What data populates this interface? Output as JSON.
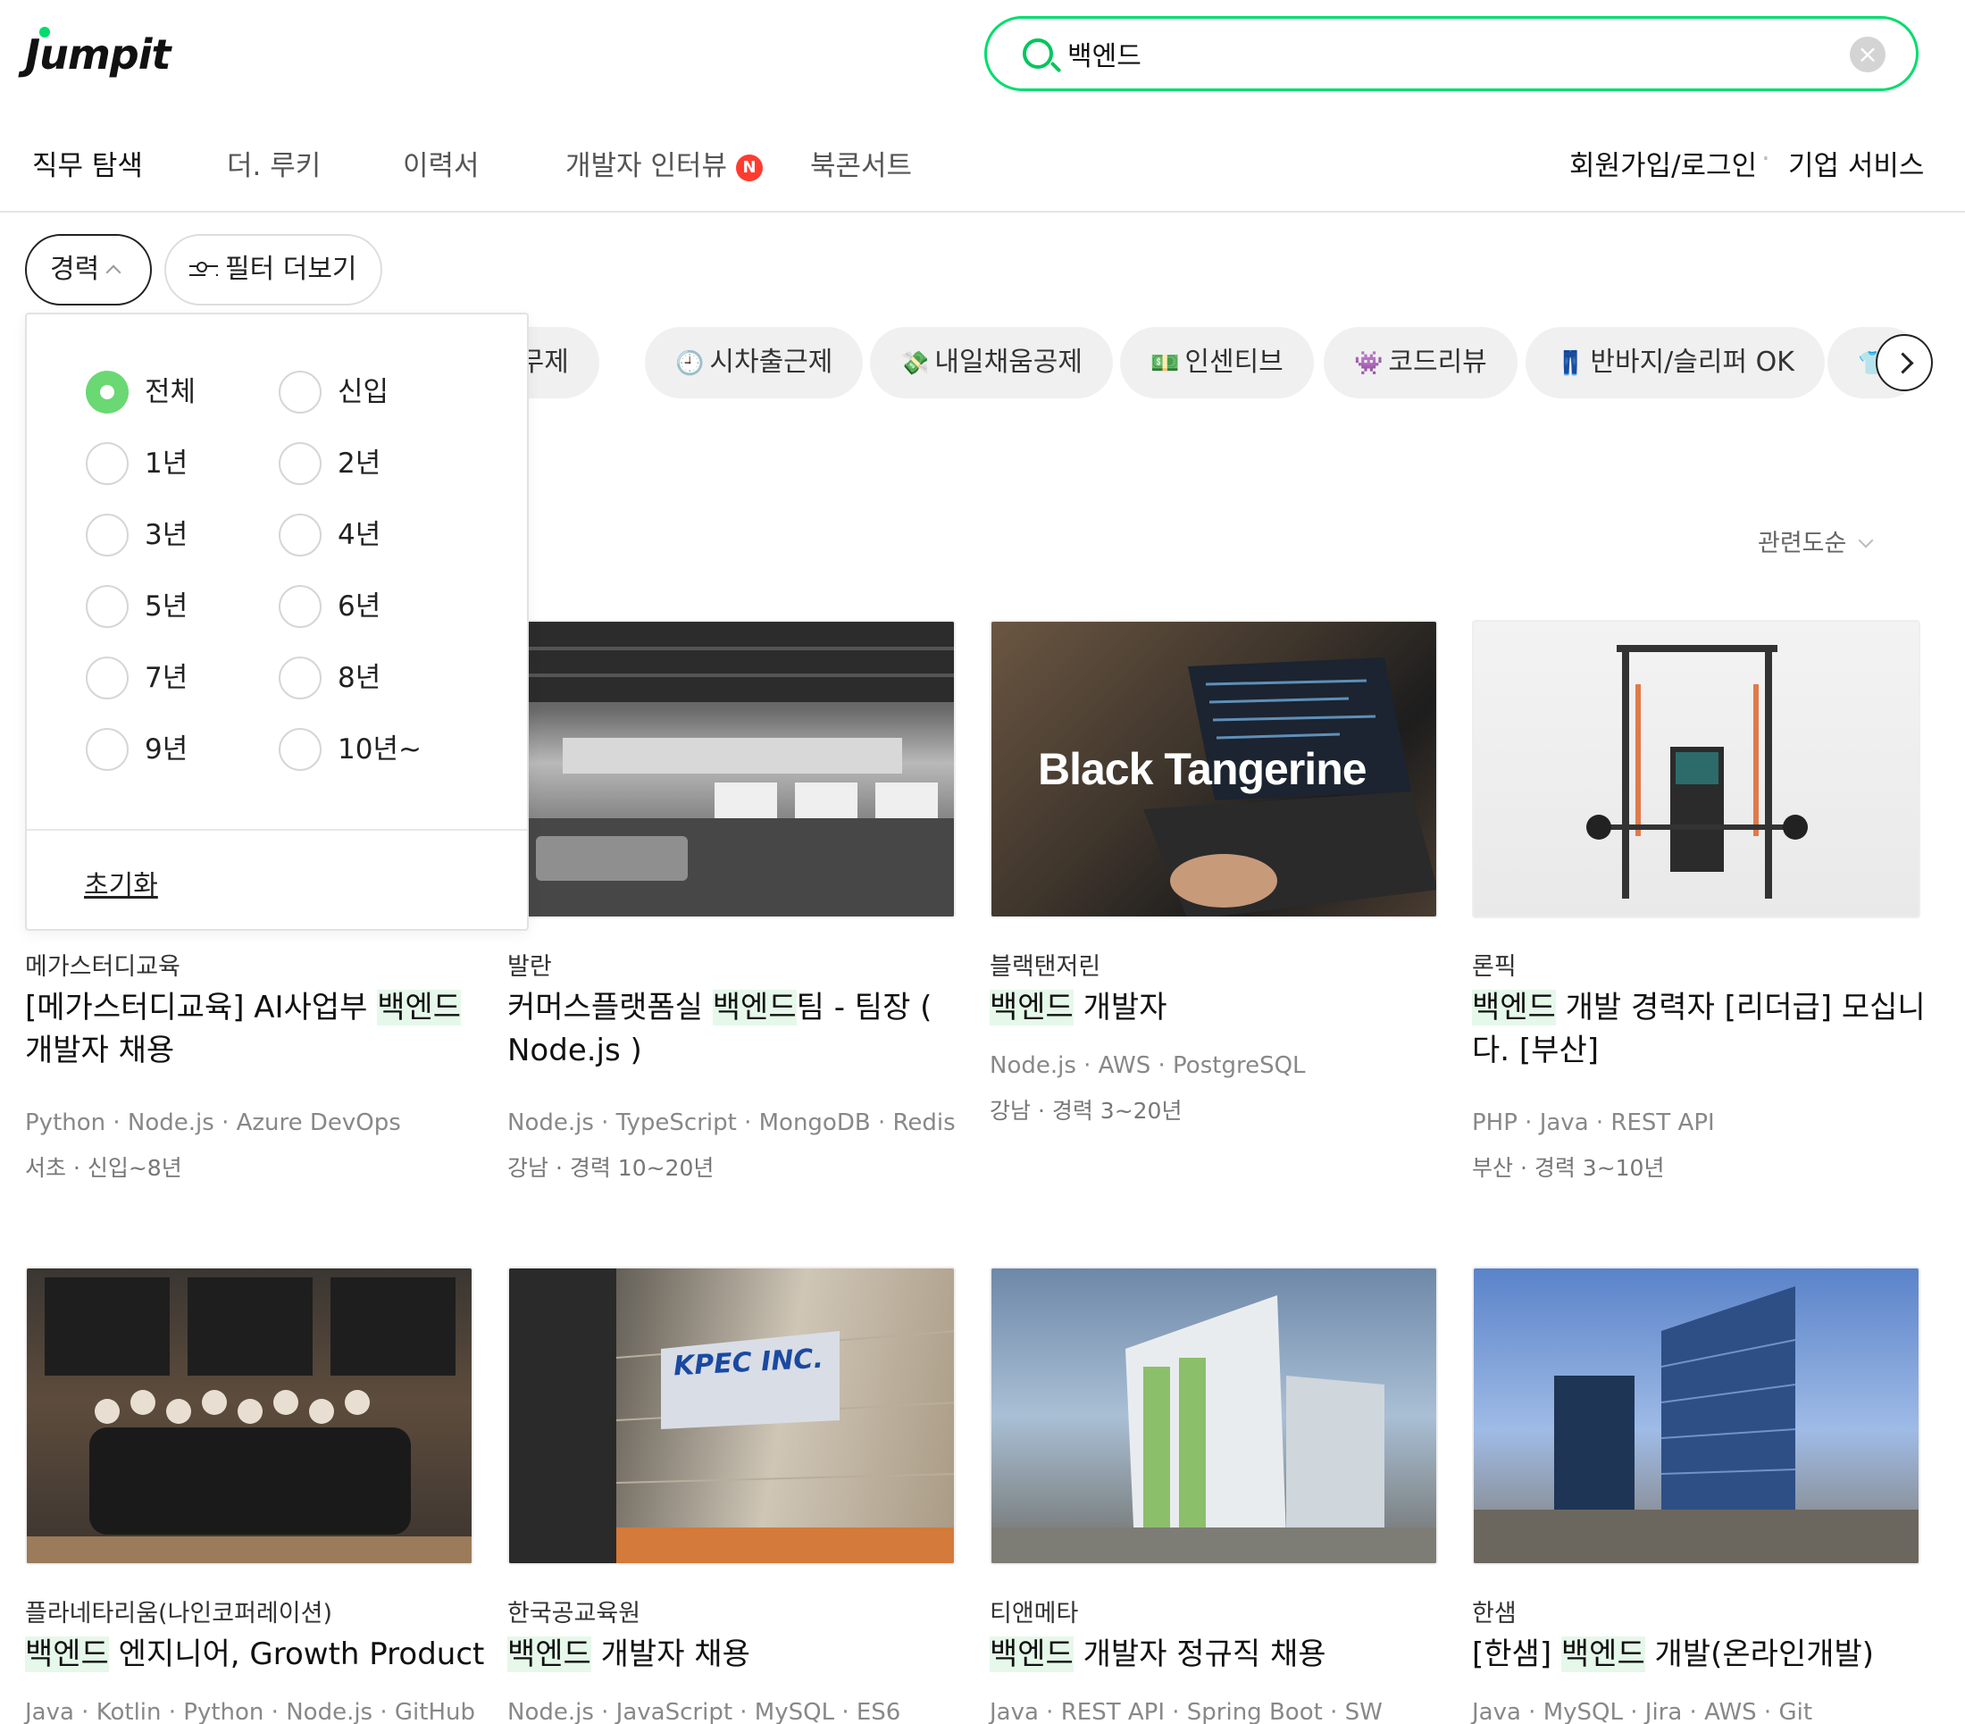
{
  "header": {
    "logo": "Jumpit",
    "search": {
      "value": "백엔드",
      "placeholder": ""
    },
    "nav": [
      "직무 탐색",
      "더. 루키",
      "이력서",
      "개발자 인터뷰",
      "북콘서트"
    ],
    "nav_badge": "N",
    "right": [
      "회원가입/로그인",
      "기업 서비스"
    ]
  },
  "filters": {
    "career": "경력",
    "more": "필터 더보기",
    "tags": [
      {
        "icon": "",
        "label": "근무제"
      },
      {
        "icon": "🕘",
        "label": "시차출근제"
      },
      {
        "icon": "💸",
        "label": "내일채움공제"
      },
      {
        "icon": "💵",
        "label": "인센티브"
      },
      {
        "icon": "👾",
        "label": "코드리뷰"
      },
      {
        "icon": "👖",
        "label": "반바지/슬리퍼 OK"
      },
      {
        "icon": "👕",
        "label": ""
      }
    ],
    "sort": "관련도순"
  },
  "dropdown": {
    "options": [
      "전체",
      "신입",
      "1년",
      "2년",
      "3년",
      "4년",
      "5년",
      "6년",
      "7년",
      "8년",
      "9년",
      "10년~"
    ],
    "selected": "전체",
    "reset": "초기화"
  },
  "cards": [
    {
      "company": "메가스터디교육",
      "title_pre": "[메가스터디교육] AI사업부 ",
      "title_hl": "백엔드",
      "title_post": " 개발자 채용",
      "stack": "Python · Node.js · Azure DevOps",
      "loc": "서초 · 신입~8년"
    },
    {
      "company": "발란",
      "title_pre": "커머스플랫폼실 ",
      "title_hl": "백엔드",
      "title_post": "팀 - 팀장 ( Node.js )",
      "stack": "Node.js · TypeScript · MongoDB · Redis",
      "loc": "강남 · 경력 10~20년"
    },
    {
      "company": "블랙탠저린",
      "title_pre": "",
      "title_hl": "백엔드",
      "title_post": " 개발자",
      "stack": "Node.js · AWS · PostgreSQL",
      "loc": "강남 · 경력 3~20년",
      "thumb_text": "Black Tangerine"
    },
    {
      "company": "론픽",
      "title_pre": "",
      "title_hl": "백엔드",
      "title_post": " 개발 경력자 [리더급] 모십니다. [부산]",
      "stack": "PHP · Java · REST API",
      "loc": "부산 · 경력 3~10년"
    },
    {
      "company": "플라네타리움(나인코퍼레이션)",
      "title_pre": "",
      "title_hl": "백엔드",
      "title_post": " 엔지니어, Growth Product",
      "stack": "Java · Kotlin · Python · Node.js · GitHub",
      "loc": ""
    },
    {
      "company": "한국공교육원",
      "title_pre": "",
      "title_hl": "백엔드",
      "title_post": " 개발자 채용",
      "stack": "Node.js · JavaScript · MySQL · ES6",
      "loc": "",
      "thumb_text": "KPEC INC."
    },
    {
      "company": "티앤메타",
      "title_pre": "",
      "title_hl": "백엔드",
      "title_post": " 개발자 정규직 채용",
      "stack": "Java · REST API · Spring Boot · SW",
      "loc": ""
    },
    {
      "company": "한샘",
      "title_pre": "[한샘] ",
      "title_hl": "백엔드",
      "title_post": " 개발(온라인개발)",
      "stack": "Java · MySQL · Jira · AWS · Git",
      "loc": ""
    }
  ]
}
